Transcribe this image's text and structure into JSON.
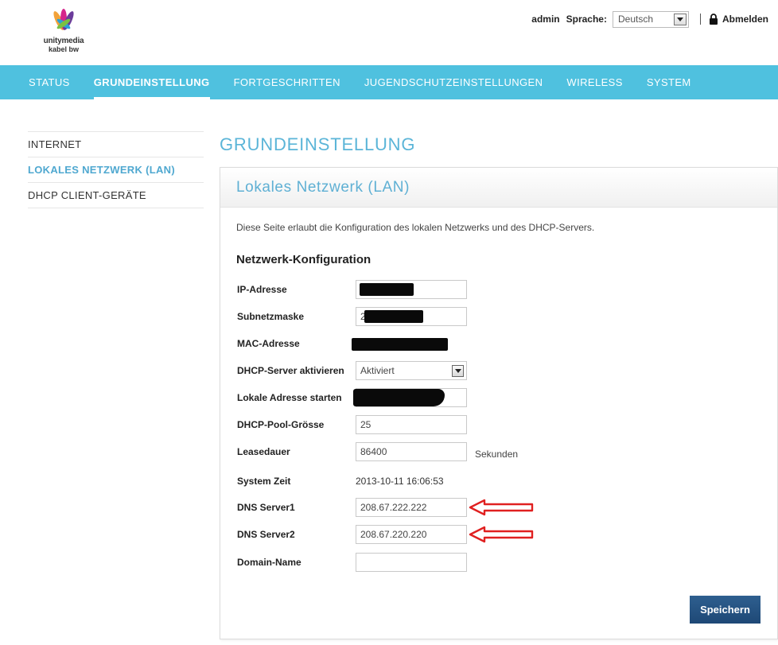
{
  "header": {
    "brand_line1": "unitymedia",
    "brand_line2": "kabel bw",
    "user": "admin",
    "language_label": "Sprache:",
    "language_value": "Deutsch",
    "logout_label": "Abmelden"
  },
  "nav": {
    "items": [
      {
        "label": "STATUS"
      },
      {
        "label": "GRUNDEINSTELLUNG",
        "active": true
      },
      {
        "label": "FORTGESCHRITTEN"
      },
      {
        "label": "JUGENDSCHUTZEINSTELLUNGEN"
      },
      {
        "label": "WIRELESS"
      },
      {
        "label": "SYSTEM"
      }
    ]
  },
  "sidebar": {
    "items": [
      {
        "label": "INTERNET"
      },
      {
        "label": "LOKALES NETZWERK (LAN)",
        "active": true
      },
      {
        "label": "DHCP CLIENT-GERÄTE"
      }
    ]
  },
  "main": {
    "page_title": "GRUNDEINSTELLUNG",
    "panel_title": "Lokales Netzwerk (LAN)",
    "description": "Diese Seite erlaubt die Konfiguration des lokalen Netzwerks und des DHCP-Servers.",
    "section_title": "Netzwerk-Konfiguration",
    "fields": {
      "ip_label": "IP-Adresse",
      "subnet_label": "Subnetzmaske",
      "subnet_value_visible": "2",
      "mac_label": "MAC-Adresse",
      "dhcp_label": "DHCP-Server aktivieren",
      "dhcp_value": "Aktiviert",
      "start_label": "Lokale Adresse starten",
      "pool_label": "DHCP-Pool-Grösse",
      "pool_value": "25",
      "lease_label": "Leasedauer",
      "lease_value": "86400",
      "lease_unit": "Sekunden",
      "time_label": "System Zeit",
      "time_value": "2013-10-11 16:06:53",
      "dns1_label": "DNS Server1",
      "dns1_value": "208.67.222.222",
      "dns2_label": "DNS Server2",
      "dns2_value": "208.67.220.220",
      "domain_label": "Domain-Name",
      "domain_value": ""
    },
    "save_label": "Speichern"
  },
  "colors": {
    "nav_bg": "#4fc1df",
    "accent": "#5bb5d8",
    "save_button": "#1e4876",
    "annotation_arrow": "#e02020"
  }
}
